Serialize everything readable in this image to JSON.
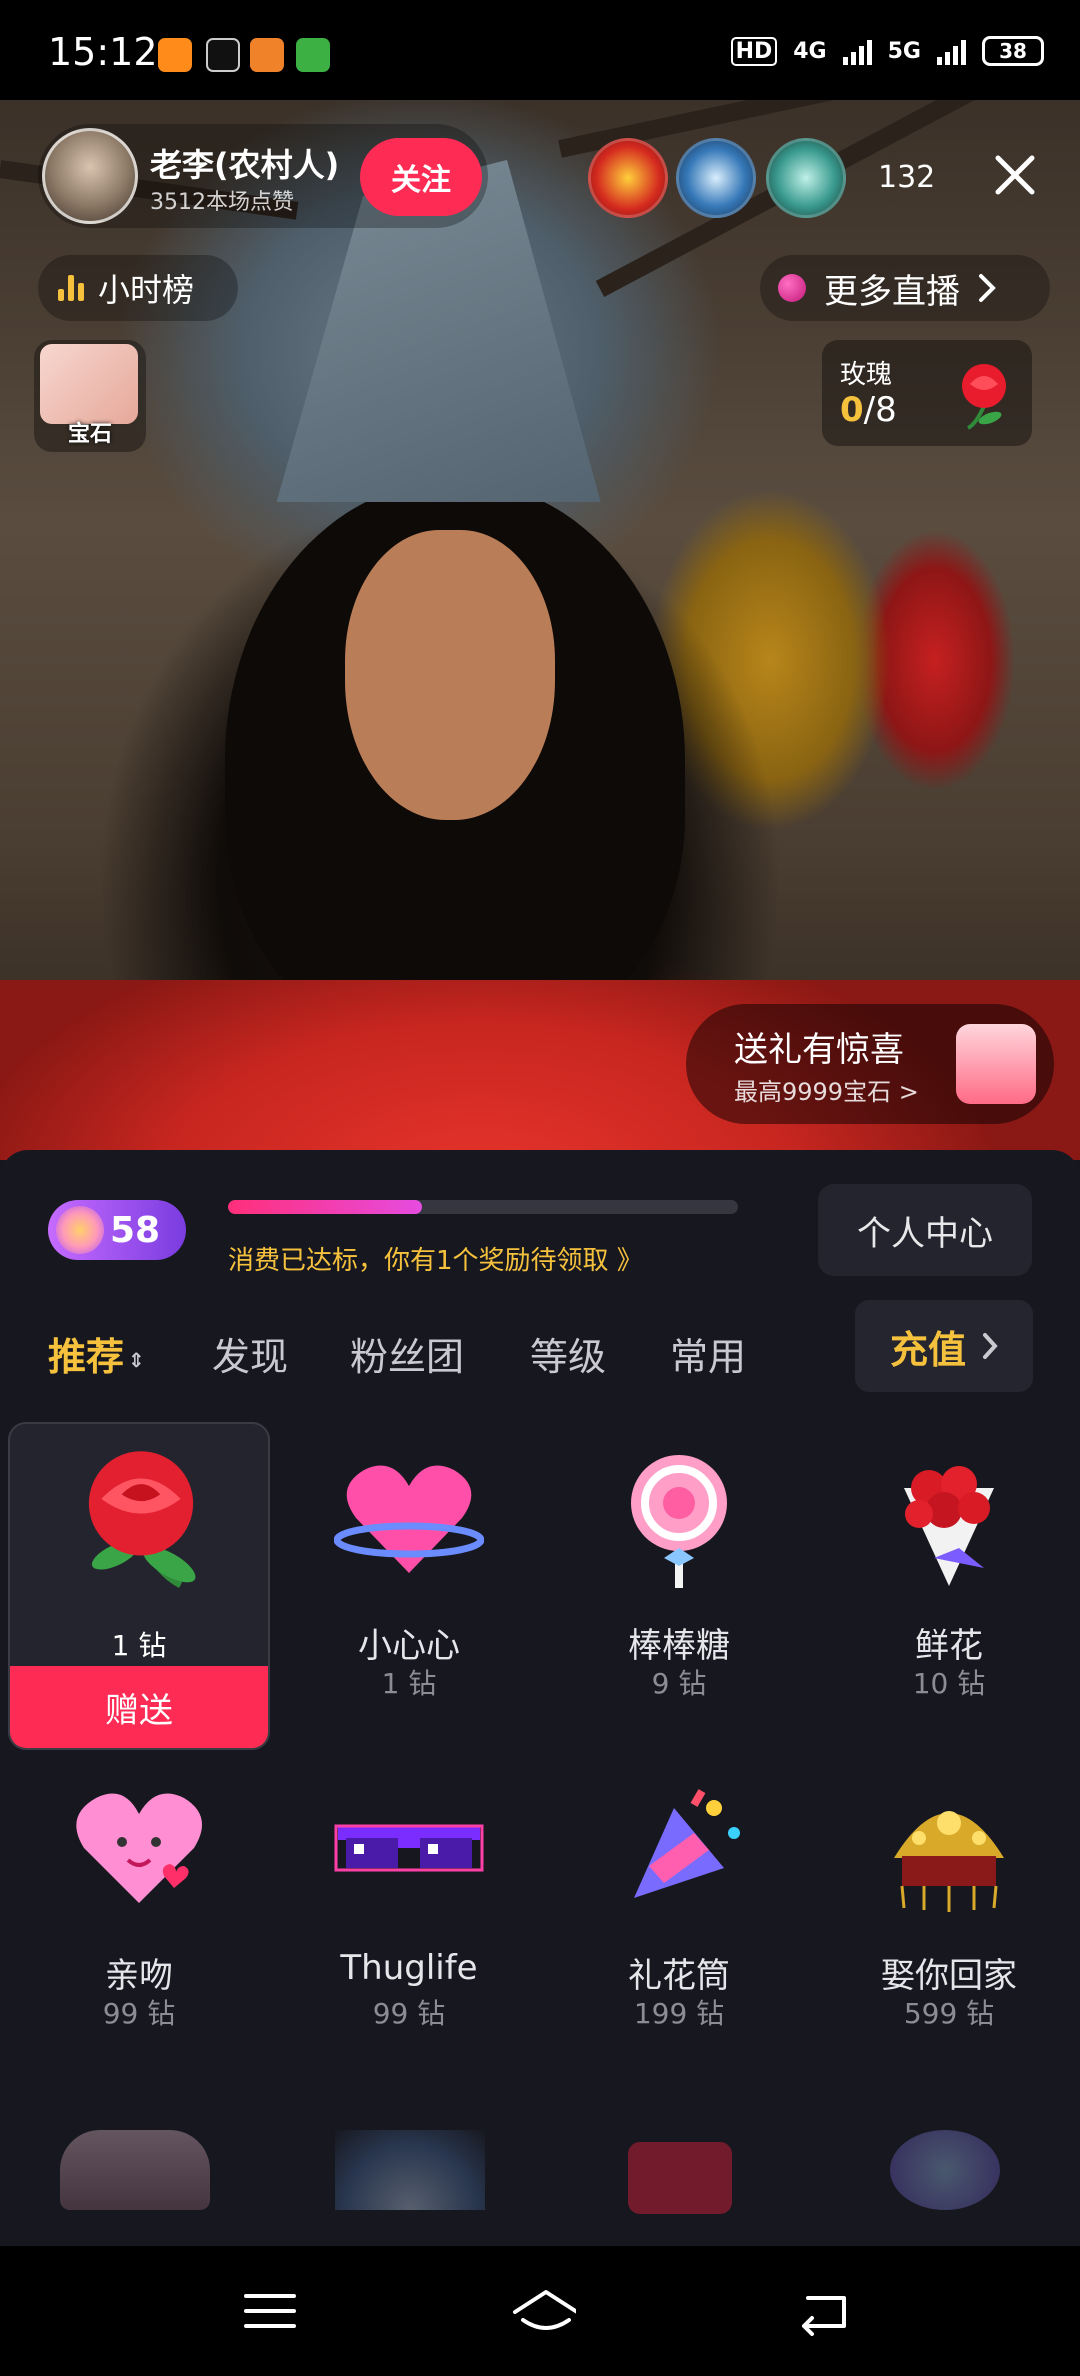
{
  "status_bar": {
    "time": "15:12",
    "network_left": "HD",
    "network_4g": "4G",
    "network_5g": "5G",
    "battery": "38"
  },
  "live": {
    "host_name": "老李(农村人)",
    "host_likes": "3512本场点赞",
    "follow_label": "关注",
    "viewer_count": "132",
    "hour_rank_label": "小时榜",
    "more_live_label": "更多直播",
    "gem_label": "宝石",
    "rose_task": {
      "title": "玫瑰",
      "current": "0",
      "total": "/8"
    },
    "surprise": {
      "title": "送礼有惊喜",
      "subtitle": "最高9999宝石 >"
    }
  },
  "panel": {
    "level": "58",
    "progress_fraction": 0.38,
    "reward_text": "消费已达标，你有1个奖励待领取 》",
    "personal_center_label": "个人中心",
    "tabs": [
      "推荐",
      "发现",
      "粉丝团",
      "等级",
      "常用"
    ],
    "recharge_label": "充值",
    "gifts": [
      {
        "name": "",
        "price": "1 钻",
        "icon": "rose-icon",
        "selected": true,
        "send_label": "赠送"
      },
      {
        "name": "小心心",
        "price": "1 钻",
        "icon": "heart-icon"
      },
      {
        "name": "棒棒糖",
        "price": "9 钻",
        "icon": "lollipop-icon"
      },
      {
        "name": "鲜花",
        "price": "10 钻",
        "icon": "bouquet-icon"
      },
      {
        "name": "亲吻",
        "price": "99 钻",
        "icon": "kiss-heart-icon"
      },
      {
        "name": "Thuglife",
        "price": "99 钻",
        "icon": "sunglasses-icon"
      },
      {
        "name": "礼花筒",
        "price": "199 钻",
        "icon": "party-popper-icon"
      },
      {
        "name": "娶你回家",
        "price": "599 钻",
        "icon": "phoenix-crown-icon"
      }
    ]
  },
  "colors": {
    "accent_red": "#fe2c55",
    "accent_gold": "#f6c23e",
    "panel_bg": "#17181f"
  }
}
